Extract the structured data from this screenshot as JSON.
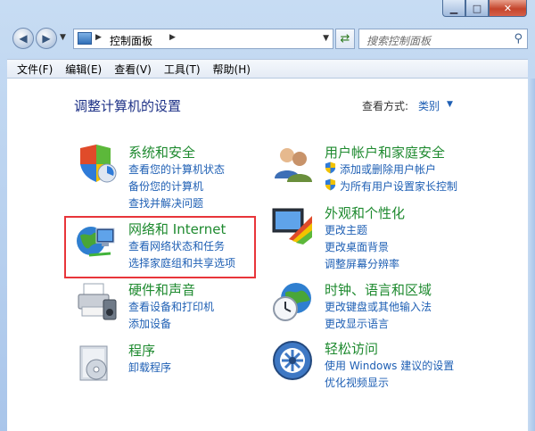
{
  "address": {
    "path": "控制面板"
  },
  "search": {
    "placeholder": "搜索控制面板"
  },
  "menu": [
    {
      "label": "文件(F)"
    },
    {
      "label": "编辑(E)"
    },
    {
      "label": "查看(V)"
    },
    {
      "label": "工具(T)"
    },
    {
      "label": "帮助(H)"
    }
  ],
  "main": {
    "title": "调整计算机的设置",
    "view_by_label": "查看方式:",
    "view_by_value": "类别"
  },
  "categories": {
    "system": {
      "title": "系统和安全",
      "links": [
        "查看您的计算机状态",
        "备份您的计算机",
        "查找并解决问题"
      ]
    },
    "network": {
      "title": "网络和 Internet",
      "links": [
        "查看网络状态和任务",
        "选择家庭组和共享选项"
      ]
    },
    "hardware": {
      "title": "硬件和声音",
      "links": [
        "查看设备和打印机",
        "添加设备"
      ]
    },
    "programs": {
      "title": "程序",
      "links": [
        "卸载程序"
      ]
    },
    "users": {
      "title": "用户帐户和家庭安全",
      "links": [
        "添加或删除用户帐户",
        "为所有用户设置家长控制"
      ]
    },
    "appearance": {
      "title": "外观和个性化",
      "links": [
        "更改主题",
        "更改桌面背景",
        "调整屏幕分辨率"
      ]
    },
    "clock": {
      "title": "时钟、语言和区域",
      "links": [
        "更改键盘或其他输入法",
        "更改显示语言"
      ]
    },
    "ease": {
      "title": "轻松访问",
      "links": [
        "使用 Windows 建议的设置",
        "优化视频显示"
      ]
    }
  },
  "colors": {
    "accent_link": "#1e5fb4",
    "category_title": "#1e8a2f",
    "page_title": "#1e3287",
    "highlight": "#e8353a"
  }
}
